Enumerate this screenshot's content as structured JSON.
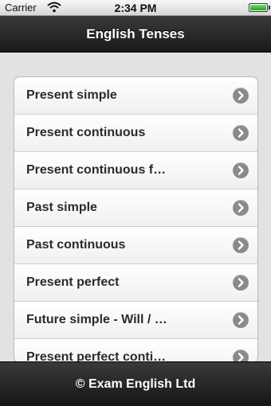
{
  "status_bar": {
    "carrier": "Carrier",
    "time": "2:34 PM",
    "wifi_icon": "wifi-icon",
    "battery_icon": "battery-icon"
  },
  "header": {
    "title": "English Tenses"
  },
  "list": {
    "items": [
      {
        "label": "Present simple",
        "icon": "chevron-right-circle-icon"
      },
      {
        "label": "Present continuous",
        "icon": "chevron-right-circle-icon"
      },
      {
        "label": "Present continuous f…",
        "icon": "chevron-right-circle-icon"
      },
      {
        "label": "Past simple",
        "icon": "chevron-right-circle-icon"
      },
      {
        "label": "Past continuous",
        "icon": "chevron-right-circle-icon"
      },
      {
        "label": "Present perfect",
        "icon": "chevron-right-circle-icon"
      },
      {
        "label": "Future simple - Will / …",
        "icon": "chevron-right-circle-icon"
      },
      {
        "label": "Present perfect conti…",
        "icon": "chevron-right-circle-icon"
      }
    ]
  },
  "footer": {
    "text": "© Exam English Ltd"
  },
  "colors": {
    "header_bg": "#1a1a1a",
    "list_text": "#2b2b2b",
    "chevron_bg": "#8a8a8a",
    "battery": "#1fa51f"
  }
}
